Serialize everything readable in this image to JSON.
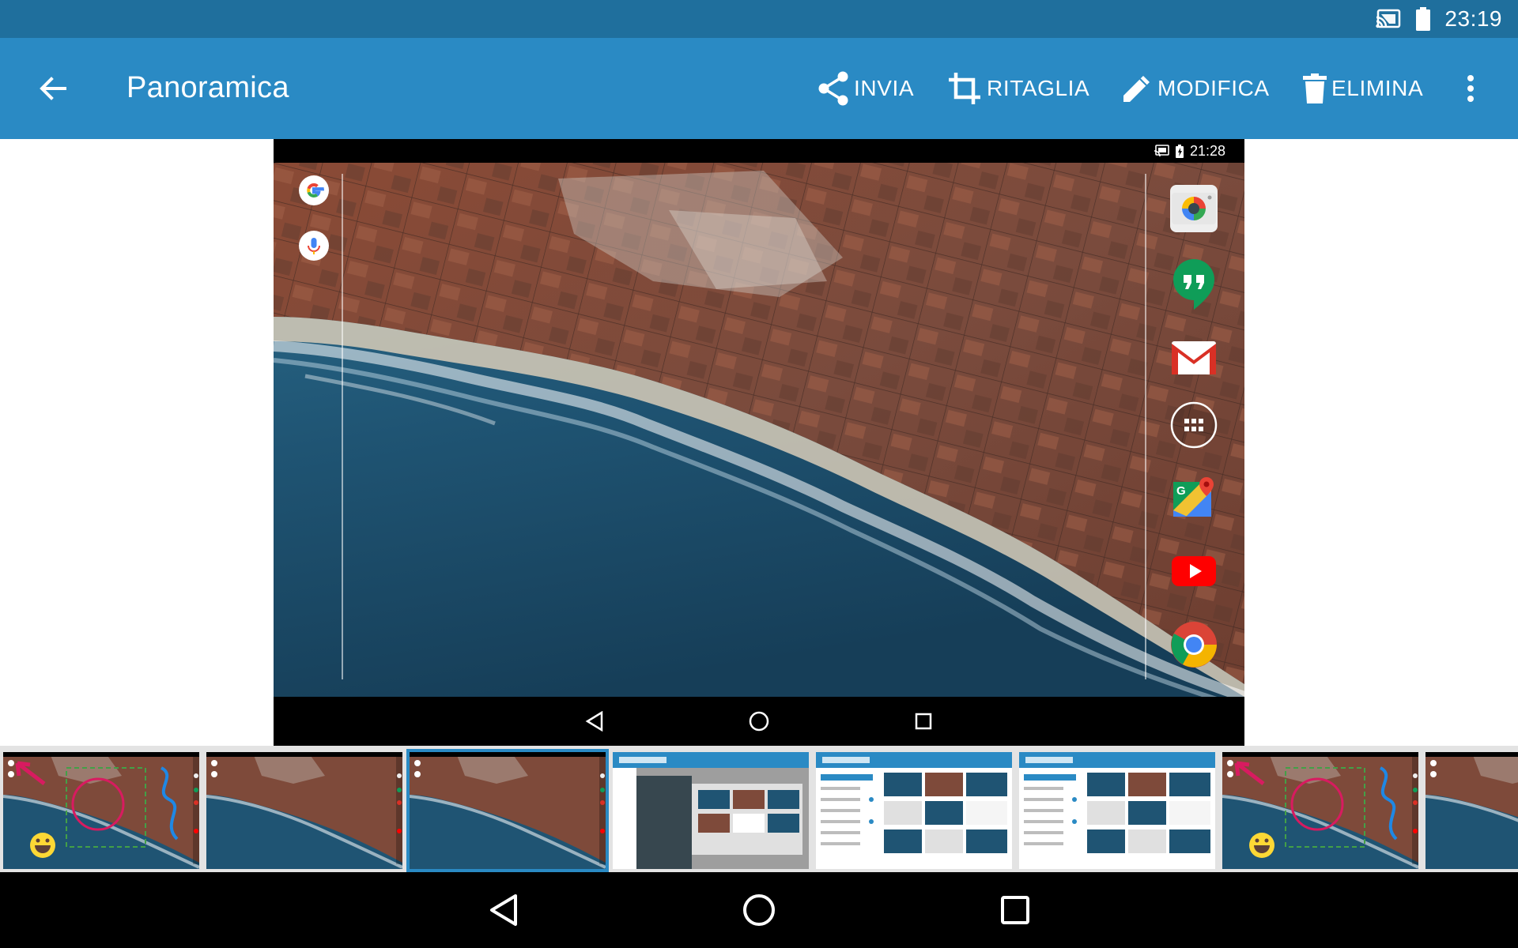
{
  "status_bar": {
    "time": "23:19"
  },
  "toolbar": {
    "title": "Panoramica",
    "actions": [
      {
        "label": "INVIA",
        "icon": "share-icon"
      },
      {
        "label": "RITAGLIA",
        "icon": "crop-icon"
      },
      {
        "label": "MODIFICA",
        "icon": "pencil-icon"
      },
      {
        "label": "ELIMINA",
        "icon": "trash-icon"
      }
    ]
  },
  "preview": {
    "status_time": "21:28",
    "dock_icons": [
      "camera-icon",
      "hangouts-icon",
      "gmail-icon",
      "app-drawer-icon",
      "maps-icon",
      "youtube-icon",
      "chrome-icon"
    ]
  },
  "thumbnails": [
    {
      "kind": "annotated",
      "selected": false
    },
    {
      "kind": "plain",
      "selected": false
    },
    {
      "kind": "plain",
      "selected": true
    },
    {
      "kind": "settings-crop",
      "selected": false
    },
    {
      "kind": "settings-list",
      "selected": false
    },
    {
      "kind": "settings-list",
      "selected": false
    },
    {
      "kind": "annotated",
      "selected": false
    },
    {
      "kind": "plain",
      "selected": false
    }
  ],
  "colors": {
    "status_bar": "#1f6f9d",
    "toolbar": "#2a8ac4",
    "accent": "#2a8ac4"
  }
}
